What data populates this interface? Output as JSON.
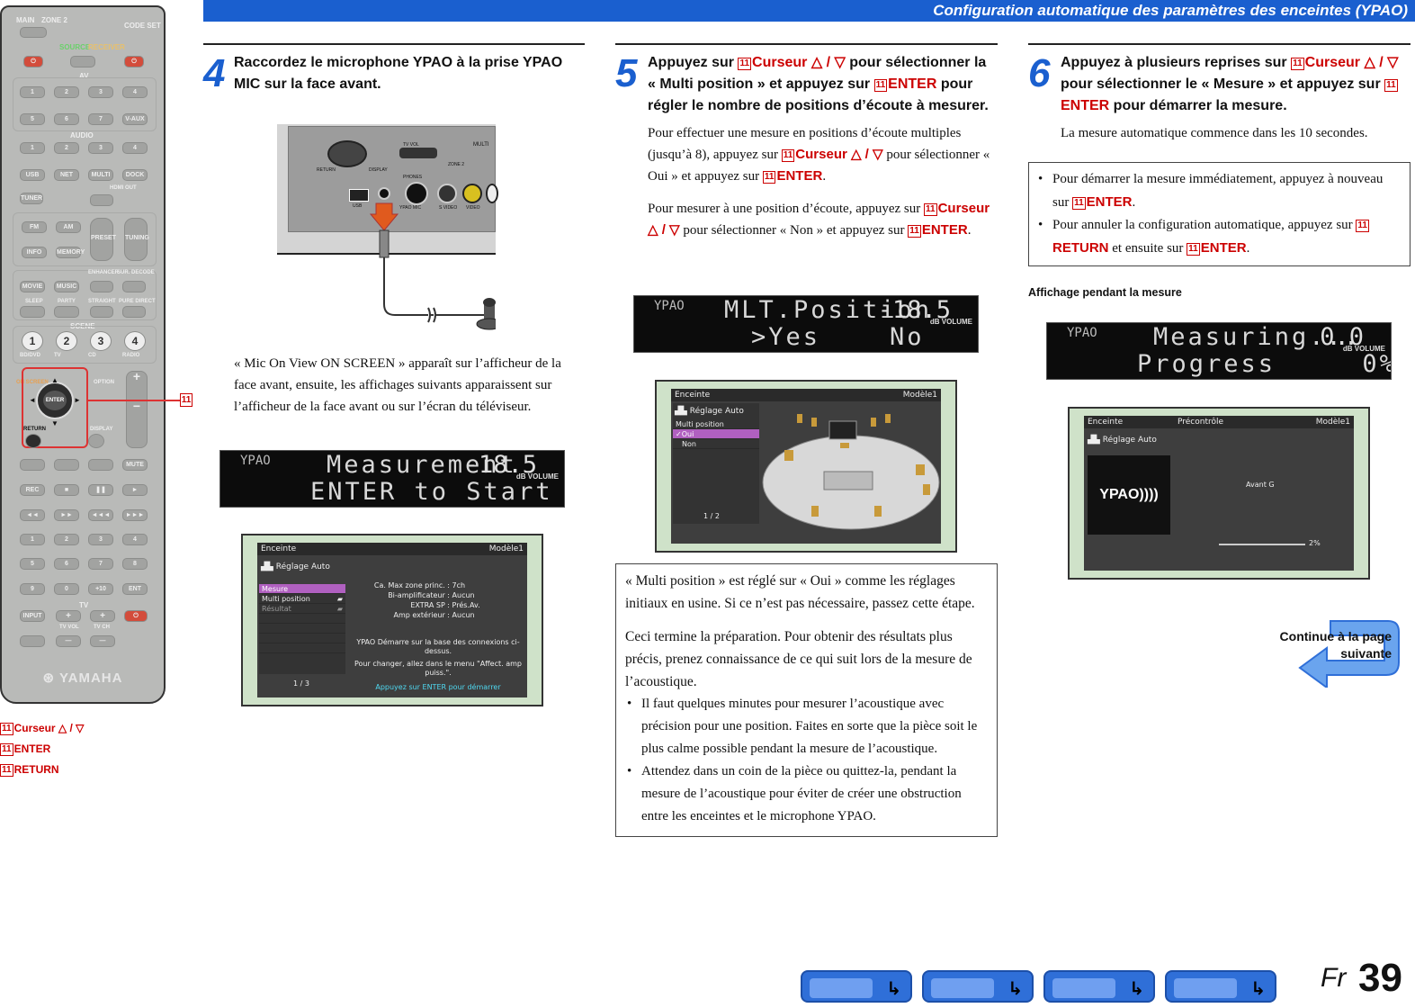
{
  "header": {
    "title": "Configuration automatique des paramètres des enceintes (YPAO)"
  },
  "remote": {
    "labels": {
      "main": "MAIN",
      "zone2": "ZONE 2",
      "codeset": "CODE SET",
      "source": "SOURCE",
      "receiver": "RECEIVER",
      "av": "AV",
      "audio": "AUDIO",
      "scene": "SCENE",
      "tv": "TV",
      "brand": "YAMAHA",
      "enter": "ENTER",
      "return": "RETURN",
      "display": "DISPLAY",
      "onscreen": "ON SCREEN",
      "option": "OPTION",
      "preset": "PRESET",
      "tuning": "TUNING",
      "enhancer": "ENHANCER",
      "surdecode": "SUR. DECODE",
      "straight": "STRAIGHT",
      "puredirect": "PURE DIRECT",
      "sleep": "SLEEP",
      "party": "PARTY",
      "hdmiout": "HDMI OUT",
      "tvvol": "TV VOL",
      "tvch": "TV CH"
    },
    "av_row1": [
      "1",
      "2",
      "3",
      "4"
    ],
    "av_row2": [
      "5",
      "6",
      "7",
      "V-AUX"
    ],
    "audio_row": [
      "1",
      "2",
      "3",
      "4"
    ],
    "src_row": [
      "USB",
      "NET",
      "MULTI",
      "DOCK"
    ],
    "tuner": "TUNER",
    "fm": "FM",
    "am": "AM",
    "info": "INFO",
    "memory": "MEMORY",
    "movie": "MOVIE",
    "music": "MUSIC",
    "scene_nums": [
      "1",
      "2",
      "3",
      "4"
    ],
    "scene_names": [
      "BD/DVD",
      "TV",
      "CD",
      "RADIO"
    ],
    "transport": [
      "REC",
      "■",
      "❚❚",
      "►"
    ],
    "transport2": [
      "◄◄",
      "►►",
      "◄◄◄",
      "►►►"
    ],
    "num1": [
      "1",
      "2",
      "3",
      "4"
    ],
    "num2": [
      "5",
      "6",
      "7",
      "8"
    ],
    "num3": [
      "9",
      "0",
      "+10",
      "ENT"
    ],
    "input": "INPUT",
    "mute": "MUTE"
  },
  "callout": {
    "ref": "11"
  },
  "legend": [
    {
      "ref": "11",
      "text": "Curseur △ / ▽"
    },
    {
      "ref": "11",
      "text": "ENTER"
    },
    {
      "ref": "11",
      "text": "RETURN"
    }
  ],
  "step4": {
    "num": "4",
    "title": "Raccordez le microphone YPAO à la prise YPAO MIC sur la face avant.",
    "panel_labels": {
      "return": "RETURN",
      "display": "DISPLAY",
      "tvvol": "TV VOL",
      "multi": "MULTI",
      "zone2": "ZONE 2",
      "phones": "PHONES",
      "ypaomic": "YPAO MIC",
      "usb": "USB",
      "svideo": "S VIDEO",
      "video": "VIDEO"
    },
    "text": "« Mic On View ON SCREEN » apparaît sur l’afficheur de la face avant, ensuite, les affichages suivants apparaissent sur l’afficheur de la face avant ou sur l’écran du téléviseur.",
    "lcd": {
      "tag": "YPAO",
      "line1": "Measurement",
      "line2": "ENTER to Start",
      "vol": "-18.5",
      "dbv": "dB VOLUME"
    },
    "osd": {
      "top_left": "Enceinte",
      "top_right": "Modèle1",
      "menu_title": "Réglage Auto",
      "items": [
        "Mesure",
        "Multi position",
        "Résultat"
      ],
      "page": "1 / 3",
      "info": [
        [
          "Ca. Max zone princ. :",
          "7ch"
        ],
        [
          "Bi-amplificateur :",
          "Aucun"
        ],
        [
          "EXTRA SP :",
          "Prés.Av."
        ],
        [
          "Amp extérieur :",
          "Aucun"
        ]
      ],
      "note1": "YPAO Démarre sur la base des connexions ci-dessus.",
      "note2": "Pour changer, allez dans le menu \"Affect. amp puiss.\".",
      "note3": "Appuyez sur ENTER pour démarrer"
    }
  },
  "step5": {
    "num": "5",
    "title_parts": [
      "Appuyez sur ",
      "Curseur △ / ▽",
      " pour sélectionner la « Multi position » et appuyez sur ",
      "ENTER",
      " pour régler le nombre de positions d’écoute à mesurer."
    ],
    "p1_parts": [
      "Pour effectuer une mesure en positions d’écoute multiples (jusqu’à 8), appuyez sur ",
      "Curseur △ / ▽",
      " pour sélectionner « Oui » et appuyez sur ",
      "ENTER",
      "."
    ],
    "p2_parts": [
      "Pour mesurer à une position d’écoute, appuyez sur ",
      "Curseur △ / ▽",
      " pour sélectionner « Non » et appuyez sur ",
      "ENTER",
      "."
    ],
    "lcd": {
      "tag": "YPAO",
      "line1": "MLT.Position",
      "line2": ">Yes    No",
      "vol": "-18.5",
      "dbv": "dB VOLUME"
    },
    "osd": {
      "top_left": "Enceinte",
      "top_right": "Modèle1",
      "menu_title": "Réglage Auto",
      "sub": "Multi position",
      "items": [
        "Oui",
        "Non"
      ],
      "page": "1 / 2"
    },
    "box_p1": "« Multi position » est réglé sur « Oui » comme les réglages initiaux en usine. Si ce n’est pas nécessaire, passez cette étape.",
    "box_p2": "Ceci termine la préparation. Pour obtenir des résultats plus précis, prenez connaissance de ce qui suit lors de la mesure de l’acoustique.",
    "box_b1": "Il faut quelques minutes pour mesurer l’acoustique avec précision pour une position. Faites en sorte que la pièce soit le plus calme possible pendant la mesure de l’acoustique.",
    "box_b2": "Attendez dans un coin de la pièce ou quittez-la, pendant la mesure de l’acoustique pour éviter de créer une obstruction entre les enceintes et le microphone YPAO."
  },
  "step6": {
    "num": "6",
    "title_parts": [
      "Appuyez à plusieurs reprises sur ",
      "Curseur △ / ▽",
      " pour sélectionner le « Mesure » et appuyez sur ",
      "ENTER",
      " pour démarrer la mesure."
    ],
    "p1": "La mesure automatique commence dans les 10 secondes.",
    "b1_parts": [
      "Pour démarrer la mesure immédiatement, appuyez à nouveau sur ",
      "ENTER",
      "."
    ],
    "b2_parts": [
      "Pour annuler la configuration automatique, appuyez sur ",
      "RETURN",
      " et ensuite sur ",
      "ENTER",
      "."
    ],
    "display_label": "Affichage pendant la mesure",
    "lcd": {
      "tag": "YPAO",
      "line1": "Measuring...",
      "line2": "Progress     0%",
      "vol": "0.0",
      "dbv": "dB VOLUME"
    },
    "osd": {
      "top_left": "Enceinte",
      "top_mid": "Précontrôle",
      "top_right": "Modèle1",
      "menu_title": "Réglage Auto",
      "logo": "YPAO))))",
      "ch": "Avant G",
      "pct": "2%"
    },
    "continue": "Continue à la page suivante"
  },
  "footer": {
    "lang": "Fr",
    "page": "39"
  }
}
